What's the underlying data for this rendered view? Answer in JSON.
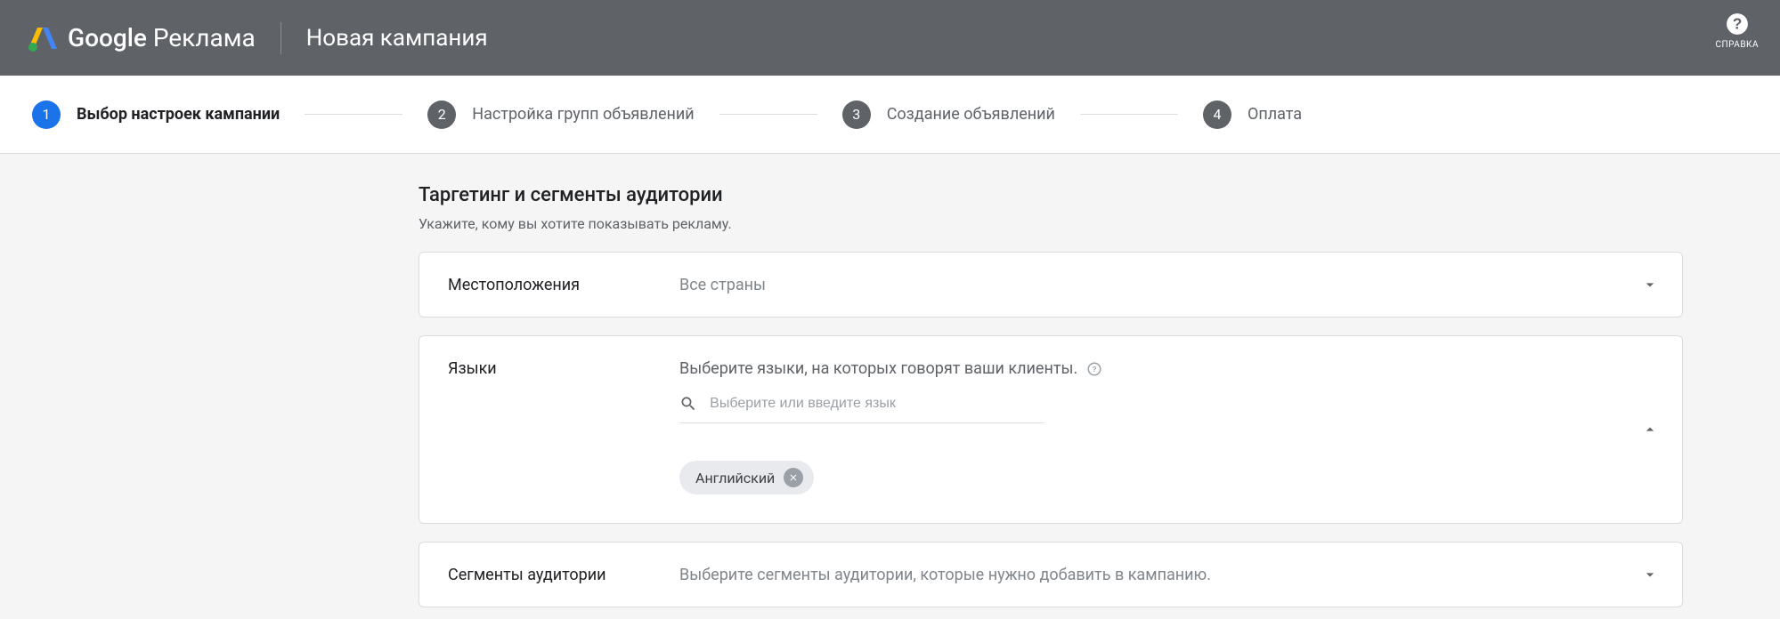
{
  "header": {
    "product": "Google",
    "brand": "Реклама",
    "title": "Новая кампания",
    "help_label": "СПРАВКА"
  },
  "stepper": {
    "steps": [
      {
        "num": "1",
        "label": "Выбор настроек кампании"
      },
      {
        "num": "2",
        "label": "Настройка групп объявлений"
      },
      {
        "num": "3",
        "label": "Создание объявлений"
      },
      {
        "num": "4",
        "label": "Оплата"
      }
    ]
  },
  "section": {
    "title": "Таргетинг и сегменты аудитории",
    "subtitle": "Укажите, кому вы хотите показывать рекламу."
  },
  "locations": {
    "label": "Местоположения",
    "value": "Все страны"
  },
  "languages": {
    "label": "Языки",
    "hint": "Выберите языки, на которых говорят ваши клиенты.",
    "search_placeholder": "Выберите или введите язык",
    "chip": "Английский"
  },
  "audiences": {
    "label": "Сегменты аудитории",
    "value": "Выберите сегменты аудитории, которые нужно добавить в кампанию."
  }
}
